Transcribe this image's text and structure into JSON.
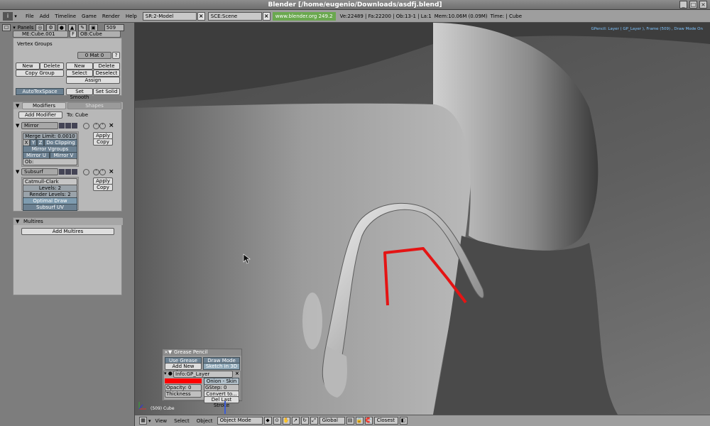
{
  "window": {
    "title": "Blender [/home/eugenio/Downloads/asdfj.blend]"
  },
  "menubar": {
    "items": [
      "File",
      "Add",
      "Timeline",
      "Game",
      "Render",
      "Help"
    ],
    "screen": "SR:2-Model",
    "scene": "SCE:Scene",
    "url": "www.blender.org 249.2",
    "stats": "Ve:22489 | Fa:22200 | Ob:13-1 | La:1",
    "mem": "Mem:10.06M (0.09M)",
    "time": "Time: | Cube"
  },
  "buttons_window": {
    "panels_label": "Panels",
    "frame": "509",
    "mesh_name": "ME:Cube.001",
    "f_label": "F",
    "object_name": "OB:Cube",
    "vertex_groups": {
      "title": "Vertex Groups",
      "mat_field": "0 Mat 0",
      "help": "?",
      "new_left": "New",
      "delete_left": "Delete",
      "copy_group": "Copy Group",
      "new_right": "New",
      "delete_right": "Delete",
      "select": "Select",
      "deselect": "Deselect",
      "assign": "Assign"
    },
    "auto_tex": "AutoTexSpace",
    "set_smooth": "Set Smooth",
    "set_solid": "Set Solid",
    "modifiers": {
      "tab_modifiers": "Modifiers",
      "tab_shapes": "Shapes",
      "add_modifier": "Add Modifier",
      "to": "To: Cube",
      "mirror": {
        "name": "Mirror",
        "merge_limit": "Merge Limit: 0.0010",
        "x": "X",
        "y": "Y",
        "z": "Z",
        "do_clipping": "Do Clipping",
        "mirror_vgroups": "Mirror Vgroups",
        "mirror_u": "Mirror U",
        "mirror_v": "Mirror V",
        "ob": "Ob:",
        "apply": "Apply",
        "copy": "Copy"
      },
      "subsurf": {
        "name": "Subsurf",
        "type": "Catmull-Clark",
        "levels": "Levels: 2",
        "render_levels": "Render Levels: 2",
        "optimal_draw": "Optimal Draw",
        "subsurf_uv": "Subsurf UV",
        "apply": "Apply",
        "copy": "Copy"
      }
    },
    "multires": {
      "title": "Multires",
      "add": "Add Multires"
    }
  },
  "viewport": {
    "gp_info": "GPencil: Layer ( GP_Layer ), Frame (509) , Draw Mode On",
    "object_label": "(509) Cube"
  },
  "grease_pencil": {
    "title": "Grease Pencil",
    "use": "Use Grease Pencil",
    "draw_mode": "Draw Mode",
    "add_layer": "Add New Layer",
    "sketch_3d": "Sketch in 3D",
    "layer_info": "Info:GP_Layer",
    "onion_skin": "Onion - Skin",
    "opacity": "Opacity: 0",
    "gstep": "GStep: 0",
    "thickness": "Thickness",
    "convert": "Convert to...",
    "del_last": "Del Last Stroke",
    "stroke_color": "#ff0000"
  },
  "bottombar": {
    "view": "View",
    "select": "Select",
    "object": "Object",
    "mode": "Object Mode",
    "orientation": "Global",
    "snap": "Closest"
  },
  "colors": {
    "curve_stroke": "#e41414",
    "viewport_text": "#7ec4ff",
    "button_active": "#6c8192",
    "url_bg": "#6aa84f"
  }
}
